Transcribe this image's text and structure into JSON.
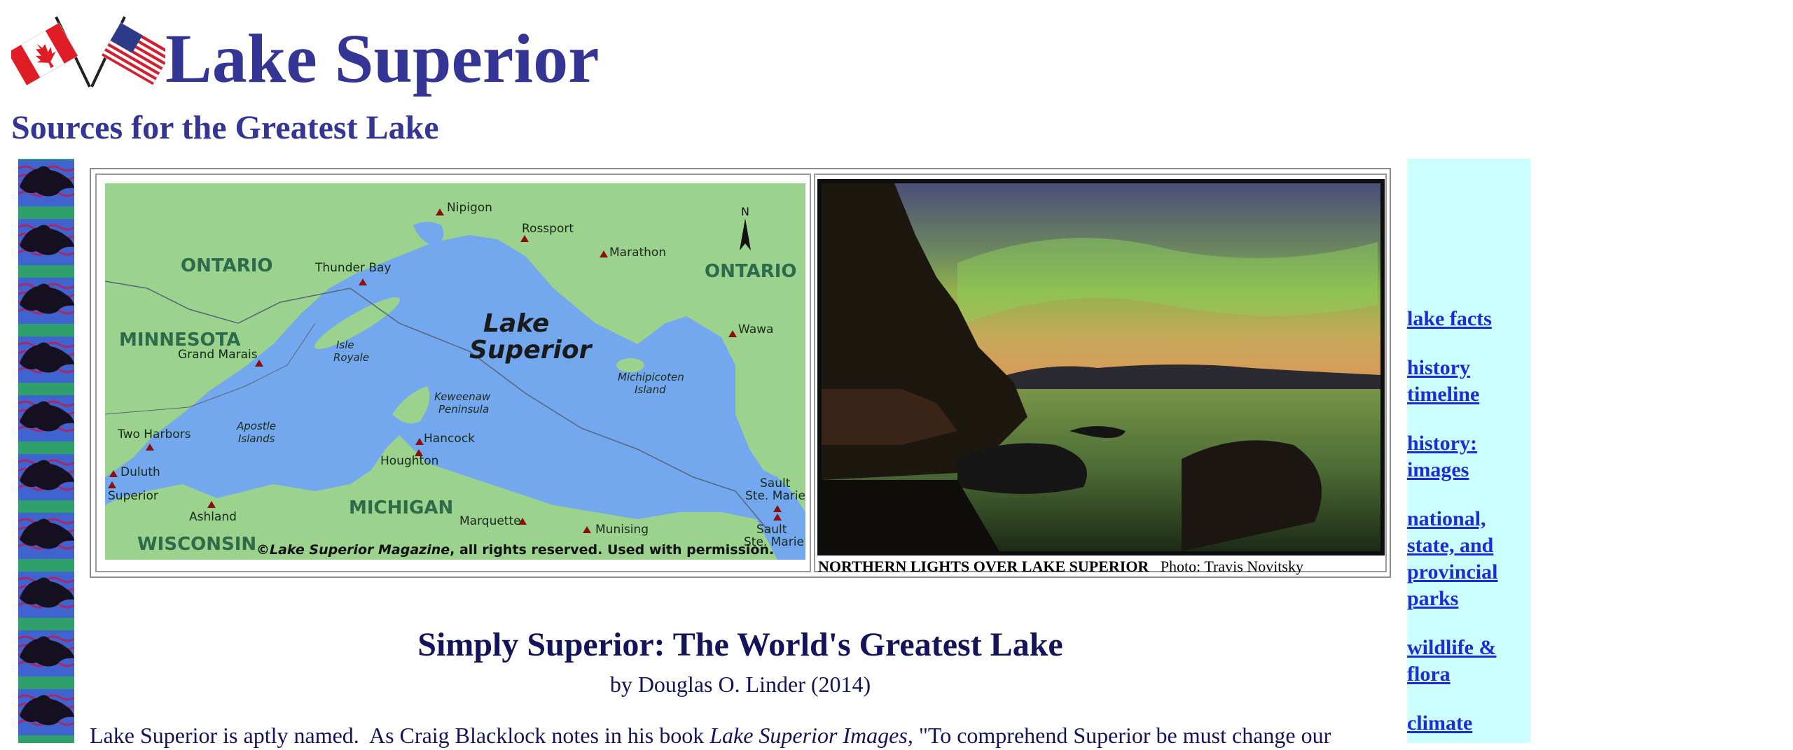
{
  "header": {
    "title": "Lake Superior",
    "subtitle": "Sources for the Greatest Lake"
  },
  "photos": {
    "map": {
      "labels": {
        "nipigon": "Nipigon",
        "rossport": "Rossport",
        "marathon": "Marathon",
        "ontario_left": "ONTARIO",
        "ontario_right": "ONTARIO",
        "thunder_bay": "Thunder Bay",
        "lake_line1": "Lake",
        "lake_line2": "Superior",
        "minnesota": "MINNESOTA",
        "grand_marais": "Grand Marais",
        "isle": "Isle",
        "royale": "Royale",
        "wawa": "Wawa",
        "michipicoten": "Michipicoten",
        "island": "Island",
        "keweenaw": "Keweenaw",
        "peninsula": "Peninsula",
        "two_harbors": "Two Harbors",
        "apostle": "Apostle",
        "islands": "Islands",
        "hancock": "Hancock",
        "houghton": "Houghton",
        "duluth": "Duluth",
        "superior": "Superior",
        "ashland": "Ashland",
        "michigan": "MICHIGAN",
        "marquette": "Marquette",
        "munising": "Munising",
        "sault1": "Sault",
        "ste_marie1": "Ste. Marie",
        "sault2": "Sault",
        "ste_marie2": "Ste. Marie",
        "wisconsin": "WISCONSIN",
        "north": "N",
        "copyright_prefix": "©",
        "copyright_magazine": "Lake Superior Magazine",
        "copyright_suffix": ", all rights reserved. Used with permission."
      }
    },
    "caption": {
      "title": "NORTHERN LIGHTS OVER LAKE SUPERIOR",
      "credit": "Photo: Travis Novitsky"
    }
  },
  "nav": {
    "items": [
      {
        "label": "lake facts"
      },
      {
        "label": "history timeline"
      },
      {
        "label": "history: images"
      },
      {
        "label": "national, state, and provincial parks"
      },
      {
        "label": "wildlife & flora"
      },
      {
        "label": "climate"
      }
    ]
  },
  "article": {
    "title": "Simply Superior: The World's Greatest Lake",
    "byline": "by Douglas O. Linder (2014)",
    "intro_start": "Lake Superior is aptly named.  As Craig Blacklock notes in his book ",
    "intro_book": "Lake Superior Images",
    "intro_end": ", \"To comprehend Superior be must change our"
  },
  "colors": {
    "title": "#353595",
    "link": "#1e2bd6",
    "nav_bg": "#ccffff",
    "lake": "#73a8ee",
    "land": "#9ad28e",
    "strip": "#2fa06a"
  },
  "icons": [
    "canada-flag-icon",
    "usa-flag-icon",
    "lake-superior-tile-icon",
    "map-marker-icon",
    "north-arrow-icon"
  ]
}
